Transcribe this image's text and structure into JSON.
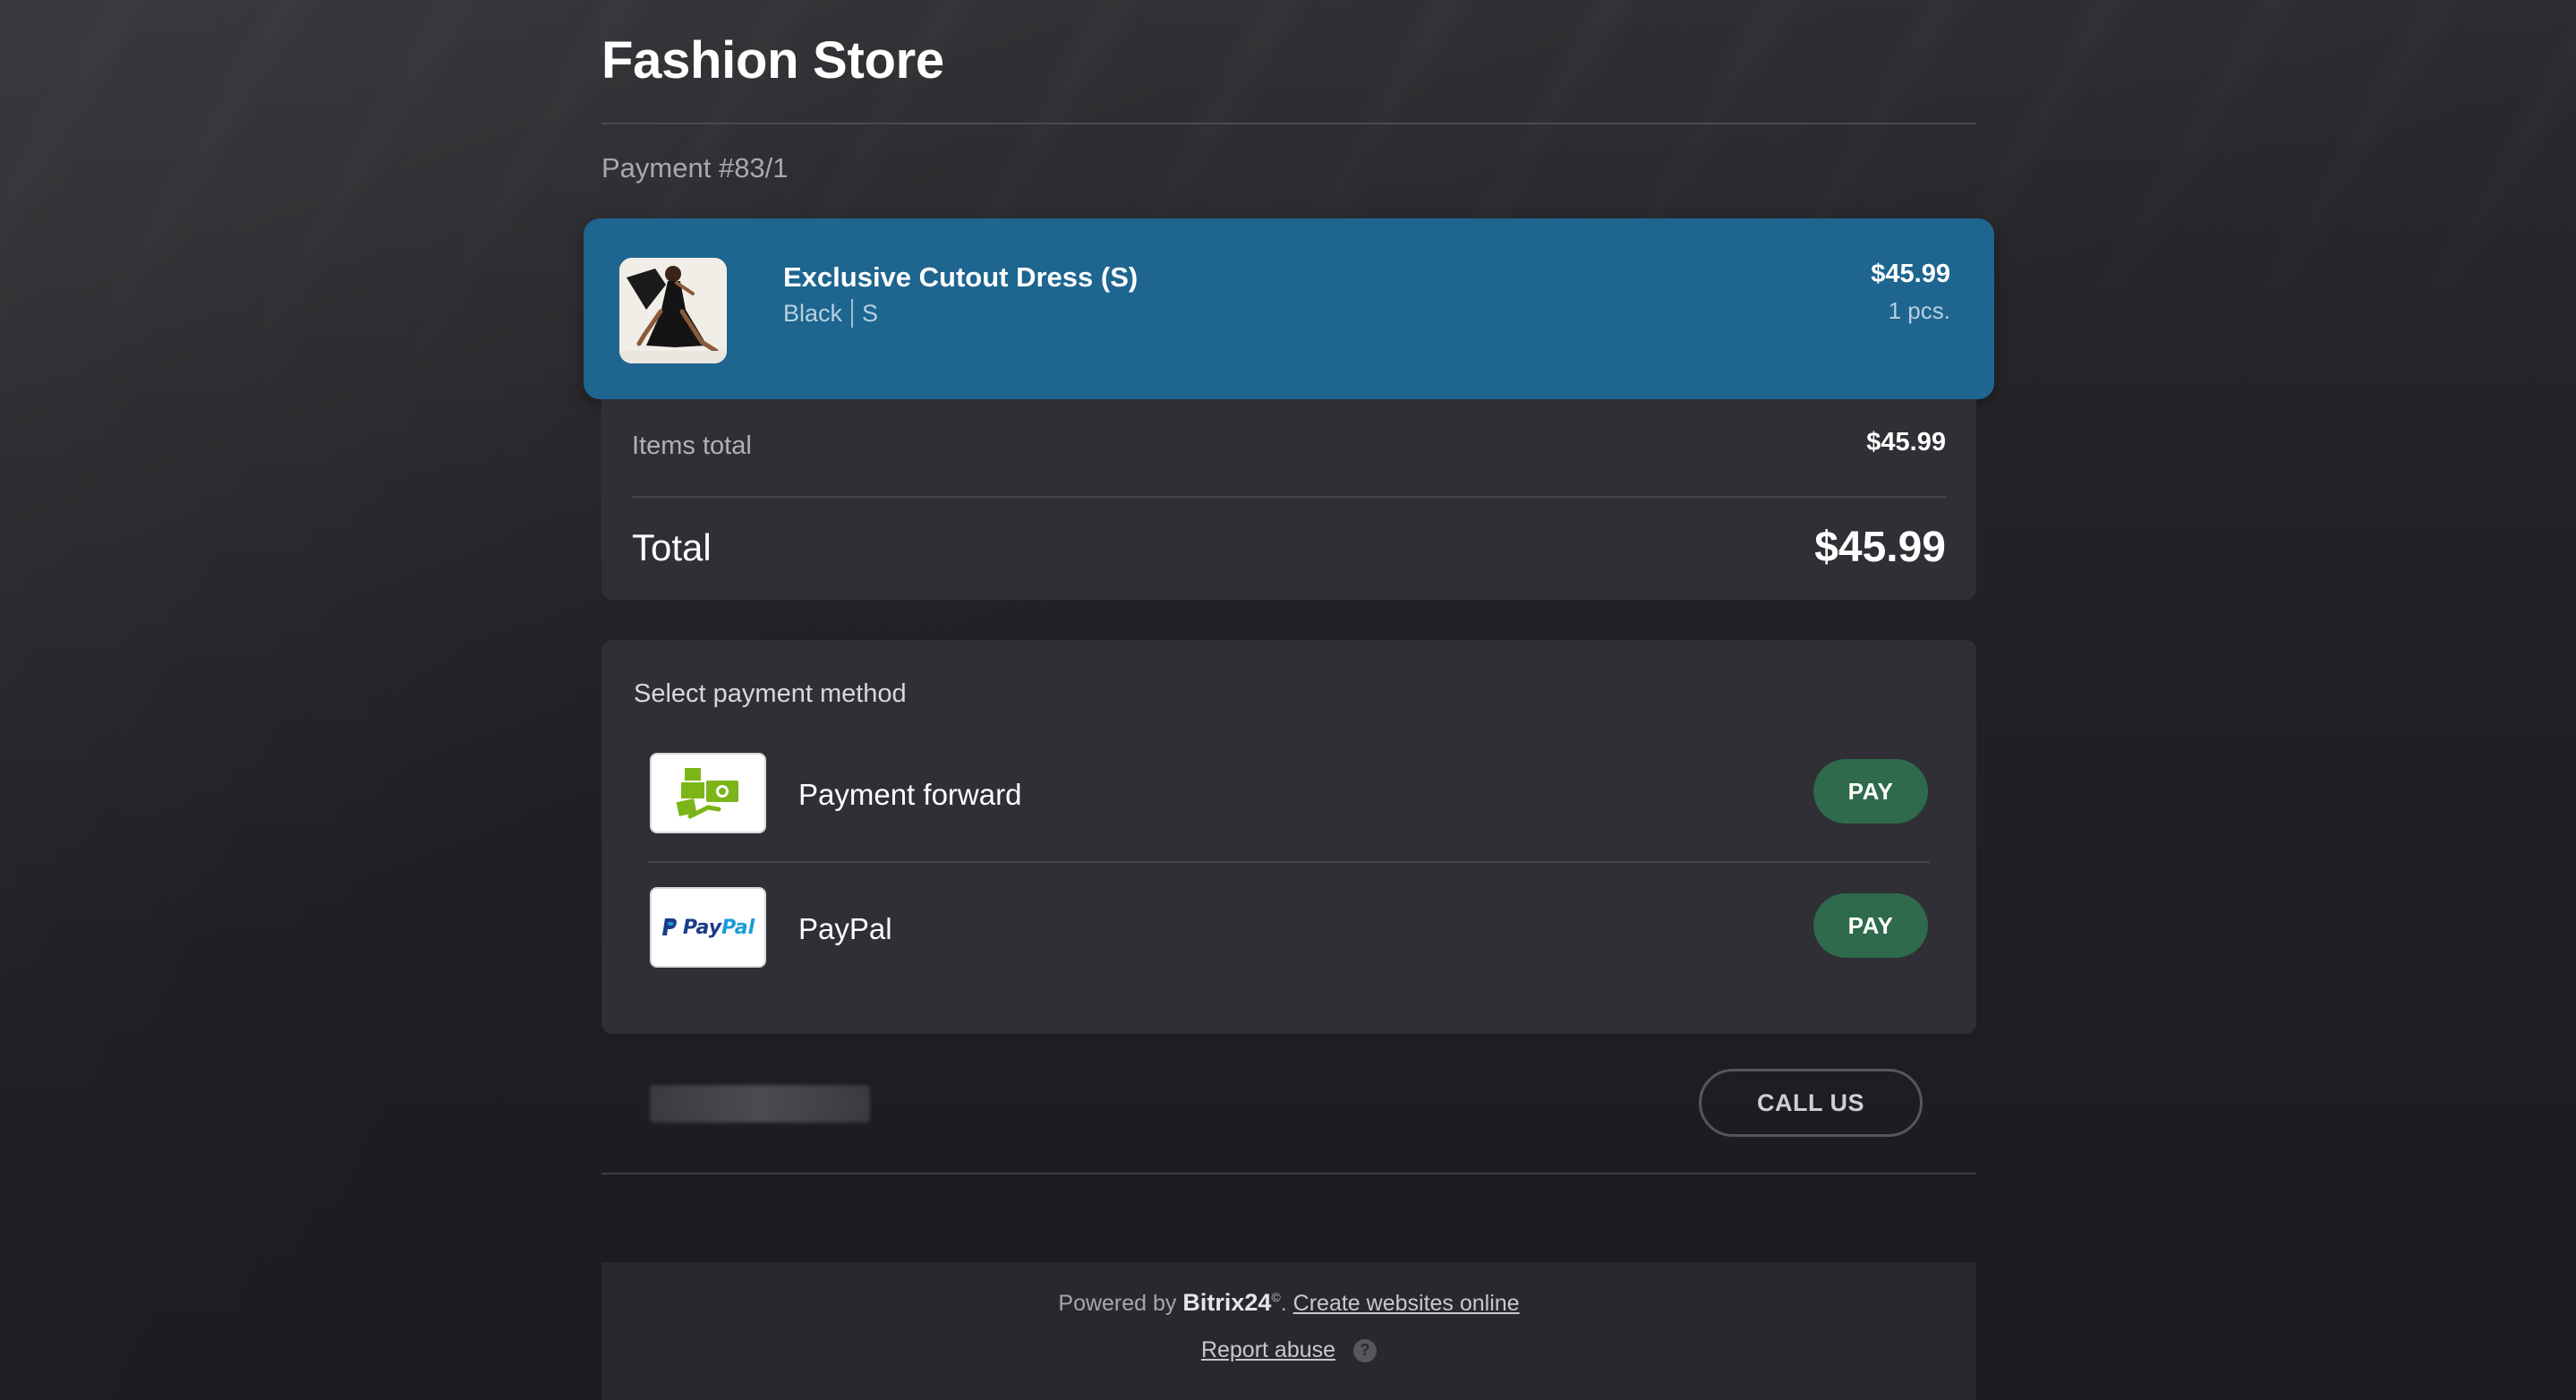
{
  "store": {
    "title": "Fashion Store",
    "payment_id": "Payment #83/1"
  },
  "product": {
    "name": "Exclusive Cutout Dress (S)",
    "color": "Black",
    "size": "S",
    "price": "$45.99",
    "quantity": "1 pcs.",
    "image_icon": "dress-photo"
  },
  "totals": {
    "items_total_label": "Items total",
    "items_total_value": "$45.99",
    "total_label": "Total",
    "total_value": "$45.99"
  },
  "payment": {
    "heading": "Select payment method",
    "methods": [
      {
        "name": "Payment forward",
        "icon": "cash-boxes-icon",
        "button": "PAY"
      },
      {
        "name": "PayPal",
        "icon": "paypal-logo",
        "button": "PAY",
        "logo_text_a": "Pay",
        "logo_text_b": "Pal"
      }
    ]
  },
  "contact": {
    "call_button": "CALL US"
  },
  "footer": {
    "powered_prefix": "Powered by",
    "brand": "Bitrix24",
    "brand_mark": "©",
    "create_link": "Create websites online",
    "report_link": "Report abuse",
    "help_glyph": "?"
  },
  "colors": {
    "product_card": "#1e6590",
    "panel": "#2f2f35",
    "pay_button": "#2e6a4b",
    "accent_green": "#7cb518"
  }
}
